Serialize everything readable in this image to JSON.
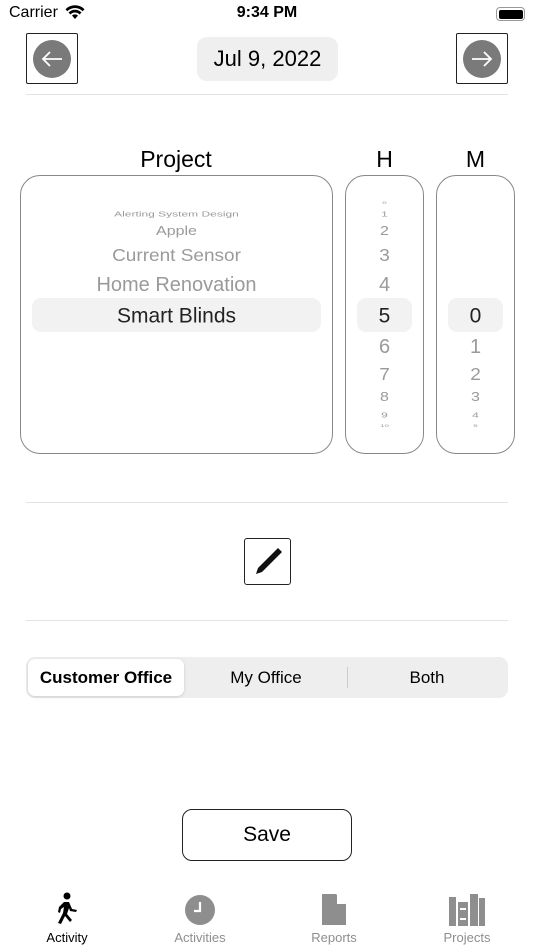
{
  "status_bar": {
    "carrier": "Carrier",
    "time": "9:34 PM"
  },
  "header": {
    "date": "Jul 9, 2022",
    "prev_icon": "arrow-left-circle",
    "next_icon": "arrow-right-circle"
  },
  "picker": {
    "project_label": "Project",
    "hours_label": "H",
    "minutes_label": "M",
    "projects": [
      "Alerting System Design",
      "Apple",
      "Current Sensor",
      "Home Renovation",
      "Smart Blinds"
    ],
    "selected_project": "Smart Blinds",
    "hours": [
      "0",
      "1",
      "2",
      "3",
      "4",
      "5",
      "6",
      "7",
      "8",
      "9",
      "10"
    ],
    "selected_hour": "5",
    "minutes": [
      "0",
      "1",
      "2",
      "3",
      "4",
      "5"
    ],
    "selected_minute": "0"
  },
  "edit_icon": "pencil",
  "location": {
    "options": [
      "Customer Office",
      "My Office",
      "Both"
    ],
    "selected": "Customer Office"
  },
  "save_label": "Save",
  "tabs": [
    {
      "label": "Activity",
      "icon": "figure-walk",
      "active": true
    },
    {
      "label": "Activities",
      "icon": "clock"
    },
    {
      "label": "Reports",
      "icon": "document"
    },
    {
      "label": "Projects",
      "icon": "books"
    }
  ]
}
